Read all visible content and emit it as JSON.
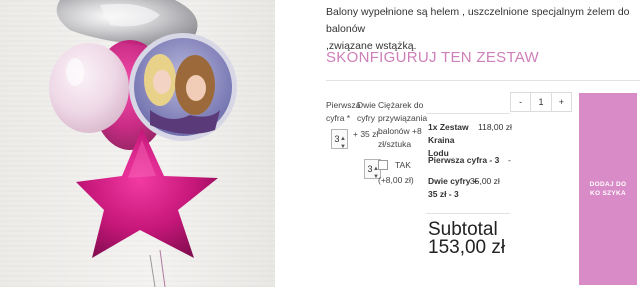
{
  "photo": {
    "alt_icon": "balloons-photo"
  },
  "description": {
    "line1": "Balony wypełnione są helem , uszczelnione  specjalnym żelem do balonów",
    "line2": ",związane wstążką."
  },
  "configure_heading": "SKONFIGURUJ TEN ZESTAW",
  "columns": {
    "first_digit": "Pierwsza cyfra *",
    "two_digits": "Dwie cyfry",
    "weight": "Ciężarek do przywiązania balonów +8 zł/sztuka"
  },
  "first_digit_select": "3",
  "two_digits_price": "+ 35 zł",
  "two_digits_select": "3",
  "weight_option": {
    "label": "TAK",
    "price": "(+8,00 zł)"
  },
  "quantity": {
    "minus": "-",
    "value": "1",
    "plus": "+"
  },
  "summary": [
    {
      "label": "1x Zestaw Kraina Lodu",
      "value": "118,00 zł"
    },
    {
      "label": "Pierwsza cyfra - 3",
      "value": "-"
    },
    {
      "label": "Dwie cyfry + 35 zł - 3",
      "value": "35,00 zł"
    }
  ],
  "subtotal": {
    "label": "Subtotal",
    "value": "153,00 zł"
  },
  "cart_button": {
    "label": "DODAJ DO KO SZYKA"
  },
  "colors": {
    "accent": "#d98bc7",
    "heading": "#cf7fb8"
  }
}
